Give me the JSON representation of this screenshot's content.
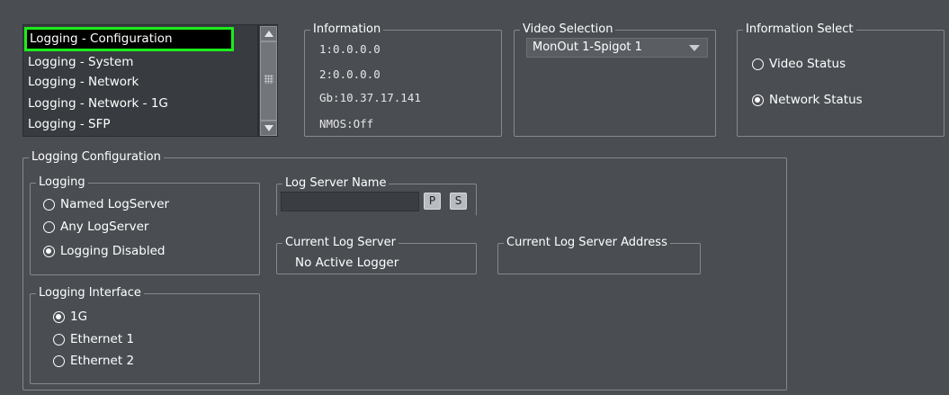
{
  "list": {
    "items": [
      {
        "label": "Logging - Configuration",
        "selected": true
      },
      {
        "label": "Logging - System",
        "selected": false
      },
      {
        "label": "Logging - Network",
        "selected": false
      },
      {
        "label": "Logging - Network - 1G",
        "selected": false
      },
      {
        "label": "Logging - SFP",
        "selected": false
      }
    ]
  },
  "information": {
    "title": "Information",
    "lines": [
      "1:0.0.0.0",
      "2:0.0.0.0",
      "Gb:10.37.17.141",
      "NMOS:Off"
    ]
  },
  "video_selection": {
    "title": "Video Selection",
    "value": "MonOut 1-Spigot 1"
  },
  "information_select": {
    "title": "Information Select",
    "options": [
      {
        "label": "Video Status",
        "checked": false
      },
      {
        "label": "Network Status",
        "checked": true
      }
    ]
  },
  "logging_configuration": {
    "title": "Logging Configuration",
    "logging": {
      "title": "Logging",
      "options": [
        {
          "label": "Named LogServer",
          "checked": false
        },
        {
          "label": "Any LogServer",
          "checked": false
        },
        {
          "label": "Logging Disabled",
          "checked": true
        }
      ]
    },
    "logging_interface": {
      "title": "Logging Interface",
      "options": [
        {
          "label": "1G",
          "checked": true
        },
        {
          "label": "Ethernet 1",
          "checked": false
        },
        {
          "label": "Ethernet 2",
          "checked": false
        }
      ]
    },
    "log_server_name": {
      "title": "Log Server Name",
      "value": "",
      "p_button": "P",
      "s_button": "S"
    },
    "current_log_server": {
      "title": "Current Log Server",
      "value": "No Active Logger"
    },
    "current_log_server_address": {
      "title": "Current Log Server Address",
      "value": ""
    }
  },
  "colors": {
    "background": "#4a4e53",
    "selection_highlight": "#1cec1c",
    "list_background": "#383c40"
  }
}
